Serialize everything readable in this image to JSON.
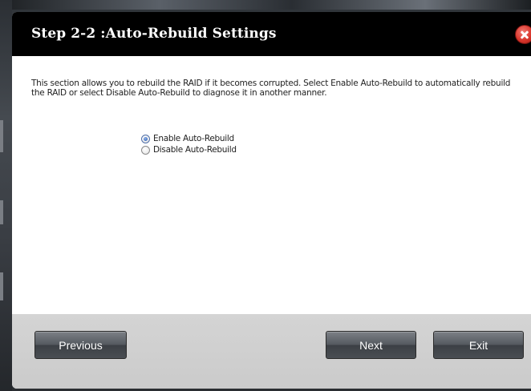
{
  "dialog": {
    "title": "Step 2-2 :Auto-Rebuild Settings",
    "description": "This section allows you to rebuild the RAID if it becomes corrupted. Select Enable Auto-Rebuild to automatically rebuild the RAID or select Disable Auto-Rebuild to diagnose it in another manner.",
    "close_icon": "close-icon"
  },
  "options": {
    "enable_label": "Enable Auto-Rebuild",
    "disable_label": "Disable Auto-Rebuild",
    "selected": "Enable Auto-Rebuild"
  },
  "footer": {
    "previous_label": "Previous",
    "next_label": "Next",
    "exit_label": "Exit"
  },
  "colors": {
    "titlebar": "#000000",
    "title_text": "#ffffff",
    "close_button": "#d9362c",
    "footer": "#cfcfcf",
    "button": "#4a4e53"
  }
}
